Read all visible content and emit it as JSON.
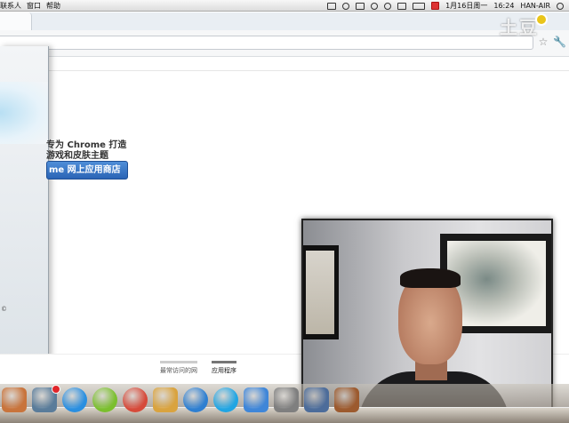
{
  "menubar": {
    "items": [
      "联系人",
      "窗口",
      "帮助"
    ],
    "date": "1月16日周一",
    "time": "16:24",
    "host": "HAN-AIR"
  },
  "watermark": {
    "text": "土豆"
  },
  "page": {
    "promo_line1": "专为 Chrome 打造",
    "promo_line2": "游戏和皮肤主题",
    "store_button": "me 网上应用商店"
  },
  "footer": {
    "tab_most_visited": "最常访问的网",
    "tab_apps": "应用程序"
  },
  "colors": {
    "store_button": "#2a64b5",
    "status_red_icon": "#d33"
  },
  "dock": {
    "icons": [
      {
        "name": "folder-icon",
        "color": "#c8743c"
      },
      {
        "name": "finder-icon",
        "color": "#5a7c9a"
      },
      {
        "name": "app-store-icon",
        "color": "#2a8fe0"
      },
      {
        "name": "spotify-icon",
        "color": "#7bbf2e"
      },
      {
        "name": "chrome-icon",
        "color": "#d64a3a"
      },
      {
        "name": "archive-icon",
        "color": "#d9a33f"
      },
      {
        "name": "itunes-icon",
        "color": "#2e7fd1"
      },
      {
        "name": "skype-icon",
        "color": "#21a5e3"
      },
      {
        "name": "ichat-icon",
        "color": "#3f86d8"
      },
      {
        "name": "system-preferences-icon",
        "color": "#7f7f7f"
      },
      {
        "name": "iphoto-icon",
        "color": "#4c6c9a"
      },
      {
        "name": "imovie-icon",
        "color": "#9c5a2e"
      }
    ]
  }
}
